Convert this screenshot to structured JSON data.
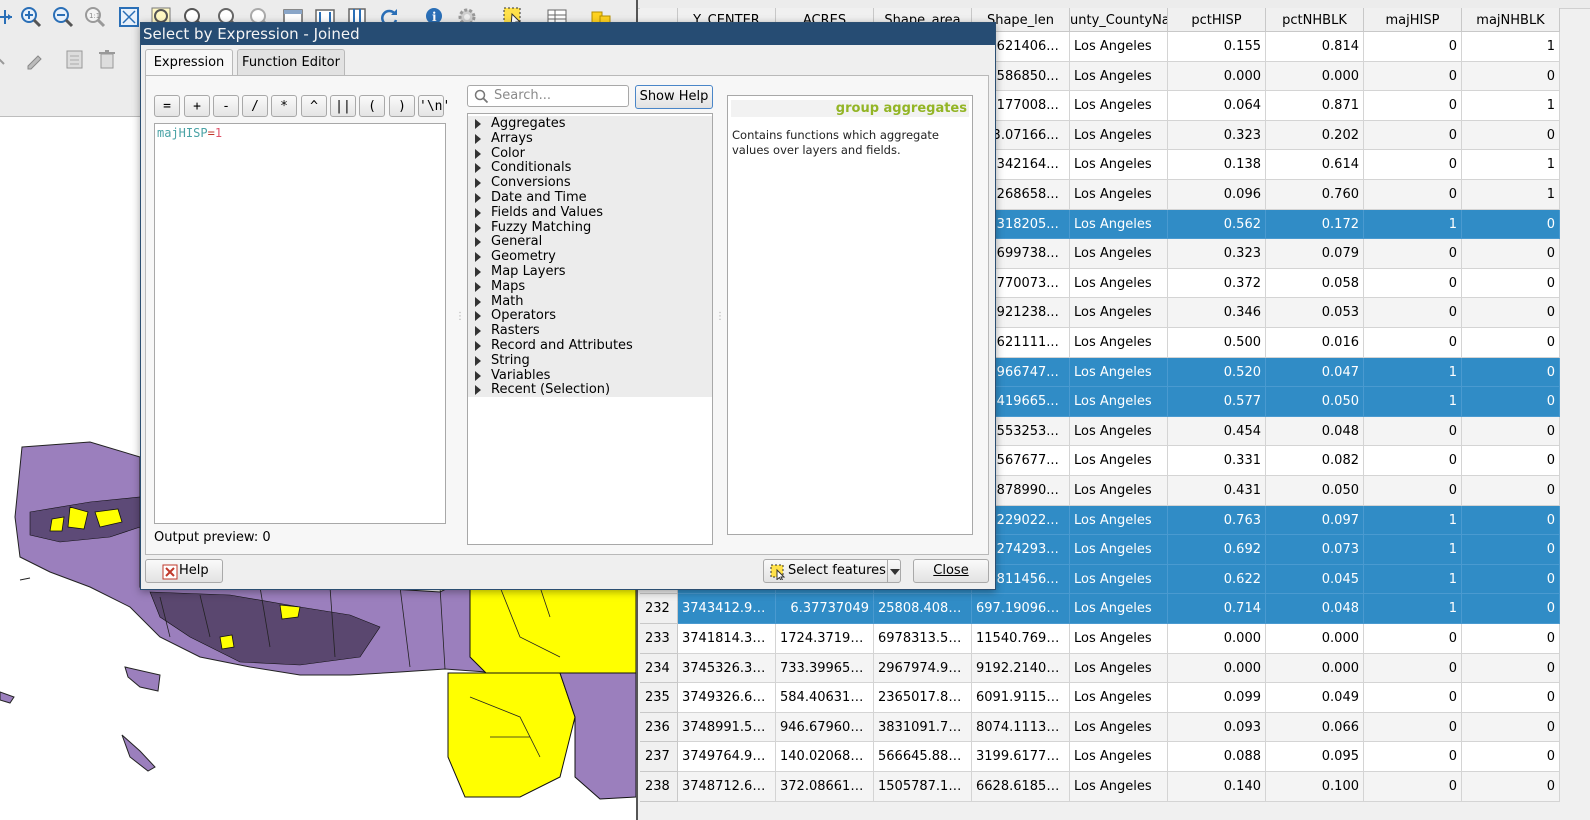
{
  "dialog": {
    "title": "Select by Expression - Joined",
    "tabs": [
      {
        "label": "Expression"
      },
      {
        "label": "Function Editor"
      }
    ],
    "operators": [
      "=",
      "+",
      "-",
      "/",
      "*",
      "^",
      "||",
      "(",
      ")",
      "'\\n'"
    ],
    "expression": {
      "field": "majHISP",
      "operator": "=",
      "value": "1"
    },
    "output_preview": "Output preview:  0",
    "search_placeholder": "Search...",
    "show_help_label": "Show Help",
    "function_groups": [
      "Aggregates",
      "Arrays",
      "Color",
      "Conditionals",
      "Conversions",
      "Date and Time",
      "Fields and Values",
      "Fuzzy Matching",
      "General",
      "Geometry",
      "Map Layers",
      "Maps",
      "Math",
      "Operators",
      "Rasters",
      "Record and Attributes",
      "String",
      "Variables",
      "Recent (Selection)"
    ],
    "help": {
      "heading": "group aggregates",
      "text": "Contains functions which aggregate values over layers and fields."
    },
    "help_button_label": "Help",
    "select_features_label": "Select features",
    "close_label": "Close"
  },
  "table": {
    "headers": [
      "Y_CENTER",
      "ACRES",
      "Shape_area",
      "Shape_len",
      "unty_CountyNar",
      "pctHISP",
      "pctNHBLK",
      "majHISP",
      "majNHBLK"
    ],
    "rows": [
      {
        "num": "",
        "y": "",
        "acres": "",
        "area": "",
        "len": "34.621406...",
        "county": "Los Angeles",
        "hisp": "0.155",
        "blk": "0.814",
        "mh": "0",
        "mb": "1",
        "selected": false
      },
      {
        "num": "",
        "y": "",
        "acres": "",
        "area": "",
        "len": "5.1586850...",
        "county": "Los Angeles",
        "hisp": "0.000",
        "blk": "0.000",
        "mh": "0",
        "mb": "0",
        "selected": false
      },
      {
        "num": "",
        "y": "",
        "acres": "",
        "area": "",
        "len": "90.177008...",
        "county": "Los Angeles",
        "hisp": "0.064",
        "blk": "0.871",
        "mh": "0",
        "mb": "1",
        "selected": false
      },
      {
        "num": "",
        "y": "",
        "acres": "",
        "area": "",
        "len": "793.07166...",
        "county": "Los Angeles",
        "hisp": "0.323",
        "blk": "0.202",
        "mh": "0",
        "mb": "0",
        "selected": false
      },
      {
        "num": "",
        "y": "",
        "acres": "",
        "area": "",
        "len": "79.342164...",
        "county": "Los Angeles",
        "hisp": "0.138",
        "blk": "0.614",
        "mh": "0",
        "mb": "1",
        "selected": false
      },
      {
        "num": "",
        "y": "",
        "acres": "",
        "area": "",
        "len": "87.268658...",
        "county": "Los Angeles",
        "hisp": "0.096",
        "blk": "0.760",
        "mh": "0",
        "mb": "1",
        "selected": false
      },
      {
        "num": "",
        "y": "",
        "acres": "",
        "area": "",
        "len": "46.318205...",
        "county": "Los Angeles",
        "hisp": "0.562",
        "blk": "0.172",
        "mh": "1",
        "mb": "0",
        "selected": true
      },
      {
        "num": "",
        "y": "",
        "acres": "",
        "area": "",
        "len": "93.699738...",
        "county": "Los Angeles",
        "hisp": "0.323",
        "blk": "0.079",
        "mh": "0",
        "mb": "0",
        "selected": false
      },
      {
        "num": "",
        "y": "",
        "acres": "",
        "area": "",
        "len": "23.770073...",
        "county": "Los Angeles",
        "hisp": "0.372",
        "blk": "0.058",
        "mh": "0",
        "mb": "0",
        "selected": false
      },
      {
        "num": "",
        "y": "",
        "acres": "",
        "area": "",
        "len": "83.921238...",
        "county": "Los Angeles",
        "hisp": "0.346",
        "blk": "0.053",
        "mh": "0",
        "mb": "0",
        "selected": false
      },
      {
        "num": "",
        "y": "",
        "acres": "",
        "area": "",
        "len": "03.621111...",
        "county": "Los Angeles",
        "hisp": "0.500",
        "blk": "0.016",
        "mh": "0",
        "mb": "0",
        "selected": false
      },
      {
        "num": "",
        "y": "",
        "acres": "",
        "area": "",
        "len": "99.966747...",
        "county": "Los Angeles",
        "hisp": "0.520",
        "blk": "0.047",
        "mh": "1",
        "mb": "0",
        "selected": true
      },
      {
        "num": "",
        "y": "",
        "acres": "",
        "area": "",
        "len": "41.419665...",
        "county": "Los Angeles",
        "hisp": "0.577",
        "blk": "0.050",
        "mh": "1",
        "mb": "0",
        "selected": true
      },
      {
        "num": "",
        "y": "",
        "acres": "",
        "area": "",
        "len": "40.553253...",
        "county": "Los Angeles",
        "hisp": "0.454",
        "blk": "0.048",
        "mh": "0",
        "mb": "0",
        "selected": false
      },
      {
        "num": "",
        "y": "",
        "acres": "",
        "area": "",
        "len": "86.567677...",
        "county": "Los Angeles",
        "hisp": "0.331",
        "blk": "0.082",
        "mh": "0",
        "mb": "0",
        "selected": false
      },
      {
        "num": "",
        "y": "",
        "acres": "",
        "area": "",
        "len": "60.878990...",
        "county": "Los Angeles",
        "hisp": "0.431",
        "blk": "0.050",
        "mh": "0",
        "mb": "0",
        "selected": false
      },
      {
        "num": "",
        "y": "",
        "acres": "",
        "area": "",
        "len": "78.229022...",
        "county": "Los Angeles",
        "hisp": "0.763",
        "blk": "0.097",
        "mh": "1",
        "mb": "0",
        "selected": true
      },
      {
        "num": "",
        "y": "",
        "acres": "",
        "area": "",
        "len": "71.274293...",
        "county": "Los Angeles",
        "hisp": "0.692",
        "blk": "0.073",
        "mh": "1",
        "mb": "0",
        "selected": true
      },
      {
        "num": "",
        "y": "",
        "acres": "",
        "area": "",
        "len": "14.811456...",
        "county": "Los Angeles",
        "hisp": "0.622",
        "blk": "0.045",
        "mh": "1",
        "mb": "0",
        "selected": true
      },
      {
        "num": "232",
        "y": "3743412.987...",
        "acres": "6.37737049",
        "area": "25808.40820...",
        "len": "697.1909651...",
        "county": "Los Angeles",
        "hisp": "0.714",
        "blk": "0.048",
        "mh": "1",
        "mb": "0",
        "selected": true
      },
      {
        "num": "233",
        "y": "3741814.326...",
        "acres": "1724.371939...",
        "area": "6978313.577...",
        "len": "11540.76910...",
        "county": "Los Angeles",
        "hisp": "0.000",
        "blk": "0.000",
        "mh": "0",
        "mb": "0",
        "selected": false
      },
      {
        "num": "234",
        "y": "3745326.325...",
        "acres": "733.39965585",
        "area": "2967974.944...",
        "len": "9192.214052...",
        "county": "Los Angeles",
        "hisp": "0.000",
        "blk": "0.000",
        "mh": "0",
        "mb": "0",
        "selected": false
      },
      {
        "num": "235",
        "y": "3749326.638...",
        "acres": "584.40631128",
        "area": "2365017.882...",
        "len": "6091.911586...",
        "county": "Los Angeles",
        "hisp": "0.099",
        "blk": "0.049",
        "mh": "0",
        "mb": "0",
        "selected": false
      },
      {
        "num": "236",
        "y": "3748991.554...",
        "acres": "946.67960595",
        "area": "3831091.792...",
        "len": "8074.111315...",
        "county": "Los Angeles",
        "hisp": "0.093",
        "blk": "0.066",
        "mh": "0",
        "mb": "0",
        "selected": false
      },
      {
        "num": "237",
        "y": "3749764.911...",
        "acres": "140.02068699",
        "area": "566645.8806...",
        "len": "3199.617768...",
        "county": "Los Angeles",
        "hisp": "0.088",
        "blk": "0.095",
        "mh": "0",
        "mb": "0",
        "selected": false
      },
      {
        "num": "238",
        "y": "3748712.686...",
        "acres": "372.08661604",
        "area": "1505787.146...",
        "len": "6628.618596...",
        "county": "Los Angeles",
        "hisp": "0.140",
        "blk": "0.100",
        "mh": "0",
        "mb": "0",
        "selected": false
      }
    ]
  },
  "colors": {
    "selection": "#308cc6",
    "map_purple": "#9b7fbd",
    "map_yellow": "#ffff00",
    "title_bar": "#264c73",
    "help_heading": "#93b526"
  },
  "icons": [
    "pan-map-icon",
    "zoom-in-icon",
    "zoom-out-icon",
    "zoom-native-icon",
    "zoom-full-icon",
    "zoom-layer-icon",
    "zoom-selection-icon",
    "zoom-last-icon",
    "zoom-next-icon",
    "new-map-view-icon",
    "new-3d-view-icon",
    "temporal-icon",
    "refresh-icon",
    "identify-icon",
    "settings-icon",
    "select-features-icon",
    "open-table-icon",
    "statistics-icon",
    "digitize-icon",
    "edit-pencil-icon",
    "delete-icon"
  ]
}
